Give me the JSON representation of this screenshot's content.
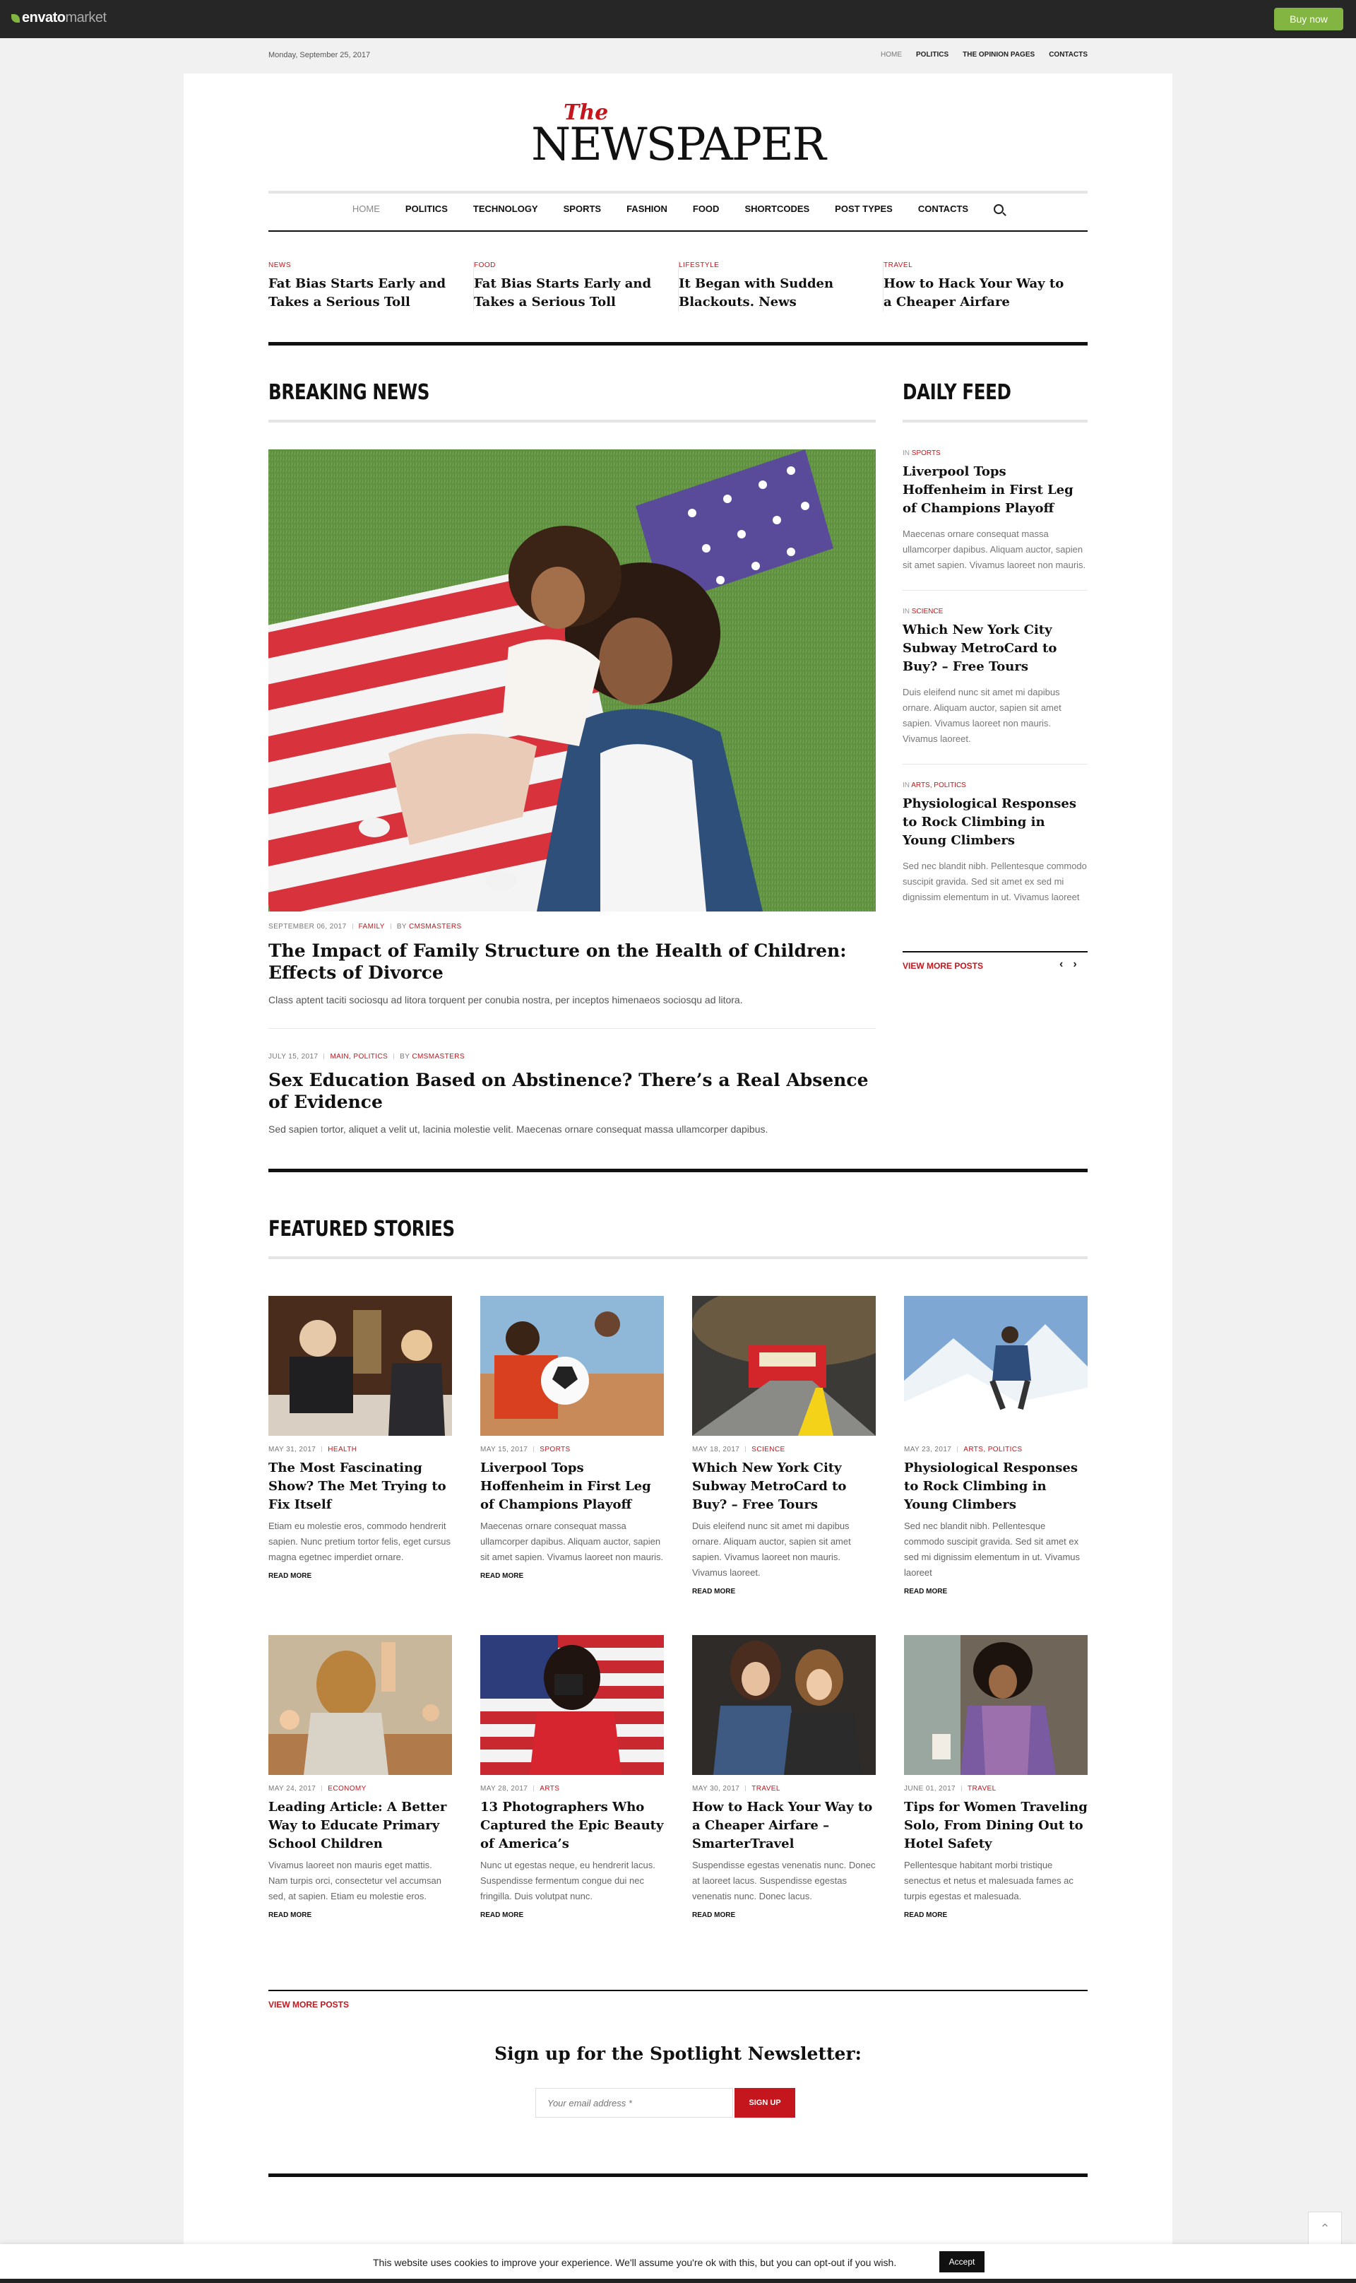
{
  "envato": {
    "logo_main": "envato",
    "logo_sub": "market",
    "buy_label": "Buy now"
  },
  "topbar": {
    "date": "Monday, September 25, 2017",
    "nav": [
      "HOME",
      "POLITICS",
      "THE OPINION PAGES",
      "CONTACTS"
    ]
  },
  "logo": {
    "the": "The",
    "main": "NEWSPAPER"
  },
  "mainnav": [
    "HOME",
    "POLITICS",
    "TECHNOLOGY",
    "SPORTS",
    "FASHION",
    "FOOD",
    "SHORTCODES",
    "POST TYPES",
    "CONTACTS"
  ],
  "ticker": [
    {
      "cat": "NEWS",
      "title": "Fat Bias Starts Early and Takes a Serious Toll"
    },
    {
      "cat": "FOOD",
      "title": "Fat Bias Starts Early and Takes a Serious Toll"
    },
    {
      "cat": "LIFESTYLE",
      "title": "It Began with Sudden Blackouts. News"
    },
    {
      "cat": "TRAVEL",
      "title": "How to Hack Your Way to a Cheaper Airfare"
    }
  ],
  "breaking": {
    "heading": "BREAKING NEWS",
    "hero": {
      "date": "SEPTEMBER 06, 2017",
      "cat": "FAMILY",
      "by": "BY",
      "author": "CMSMASTERS",
      "title": "The Impact of Family Structure on the Health of Children: Effects of Divorce",
      "excerpt": "Class aptent taciti sociosqu ad litora torquent per conubia nostra, per inceptos himenaeos sociosqu ad litora."
    },
    "second": {
      "date": "JULY 15, 2017",
      "cat": "MAIN, POLITICS",
      "by": "BY",
      "author": "CMSMASTERS",
      "title": "Sex Education Based on Abstinence? There’s a Real Absence of Evidence",
      "excerpt": "Sed sapien tortor, aliquet a velit ut, lacinia molestie velit. Maecenas ornare consequat massa ullamcorper dapibus."
    }
  },
  "feed": {
    "heading": "DAILY FEED",
    "items": [
      {
        "in": "IN",
        "cat": "SPORTS",
        "title": "Liverpool Tops Hoffenheim in First Leg of Champions Playoff",
        "excerpt": "Maecenas ornare consequat massa ullamcorper dapibus. Aliquam auctor, sapien sit amet sapien. Vivamus laoreet non mauris."
      },
      {
        "in": "IN",
        "cat": "SCIENCE",
        "title": "Which New York City Subway MetroCard to Buy? – Free Tours",
        "excerpt": "Duis eleifend nunc sit amet mi dapibus ornare. Aliquam auctor, sapien sit amet sapien. Vivamus laoreet non mauris. Vivamus laoreet."
      },
      {
        "in": "IN",
        "cat": "ARTS, POLITICS",
        "title": "Physiological Responses to Rock Climbing in Young Climbers",
        "excerpt": "Sed nec blandit nibh. Pellentesque commodo suscipit gravida. Sed sit amet ex sed mi dignissim elementum in ut. Vivamus laoreet"
      }
    ],
    "view_more": "VIEW MORE POSTS",
    "prev": "‹",
    "next": "›"
  },
  "featured": {
    "heading": "FEATURED STORIES",
    "row1": [
      {
        "date": "MAY 31, 2017",
        "cat": "HEALTH",
        "title": "The Most Fascinating Show? The Met Trying to Fix Itself",
        "excerpt": "Etiam eu molestie eros, commodo hendrerit sapien. Nunc pretium tortor felis, eget cursus magna egetnec imperdiet ornare."
      },
      {
        "date": "MAY 15, 2017",
        "cat": "SPORTS",
        "title": "Liverpool Tops Hoffenheim in First Leg of Champions Playoff",
        "excerpt": "Maecenas ornare consequat massa ullamcorper dapibus. Aliquam auctor, sapien sit amet sapien. Vivamus laoreet non mauris."
      },
      {
        "date": "MAY 18, 2017",
        "cat": "SCIENCE",
        "title": "Which New York City Subway MetroCard to Buy? – Free Tours",
        "excerpt": "Duis eleifend nunc sit amet mi dapibus ornare. Aliquam auctor, sapien sit amet sapien. Vivamus laoreet non mauris. Vivamus laoreet."
      },
      {
        "date": "MAY 23, 2017",
        "cat": "ARTS, POLITICS",
        "title": "Physiological Responses to Rock Climbing in Young Climbers",
        "excerpt": "Sed nec blandit nibh. Pellentesque commodo suscipit gravida. Sed sit amet ex sed mi dignissim elementum in ut. Vivamus laoreet"
      }
    ],
    "row2": [
      {
        "date": "MAY 24, 2017",
        "cat": "ECONOMY",
        "title": "Leading Article: A Better Way to Educate Primary School Children",
        "excerpt": "Vivamus laoreet non mauris eget mattis. Nam turpis orci, consectetur vel accumsan sed, at sapien. Etiam eu molestie eros."
      },
      {
        "date": "MAY 28, 2017",
        "cat": "ARTS",
        "title": "13 Photographers Who Captured the Epic Beauty of America’s",
        "excerpt": "Nunc ut egestas neque, eu hendrerit lacus. Suspendisse fermentum congue dui nec fringilla. Duis volutpat nunc."
      },
      {
        "date": "MAY 30, 2017",
        "cat": "TRAVEL",
        "title": "How to Hack Your Way to a Cheaper Airfare – SmarterTravel",
        "excerpt": "Suspendisse egestas venenatis nunc. Donec at laoreet lacus. Suspendisse egestas venenatis nunc. Donec lacus."
      },
      {
        "date": "JUNE 01, 2017",
        "cat": "TRAVEL",
        "title": "Tips for Women Traveling Solo, From Dining Out to Hotel Safety",
        "excerpt": "Pellentesque habitant morbi tristique senectus et netus et malesuada fames ac turpis egestas et malesuada."
      }
    ],
    "read_more": "READ MORE",
    "view_more": "VIEW MORE POSTS"
  },
  "newsletter": {
    "title": "Sign up for the Spotlight Newsletter:",
    "placeholder": "Your email address *",
    "button": "SIGN UP"
  },
  "cookie": {
    "text": "This website uses cookies to improve your experience. We'll assume you're ok with this, but you can opt-out if you wish.",
    "accept": "Accept"
  },
  "colors": {
    "accent": "#c4161c",
    "envato_green": "#82b541",
    "dark": "#111111"
  }
}
